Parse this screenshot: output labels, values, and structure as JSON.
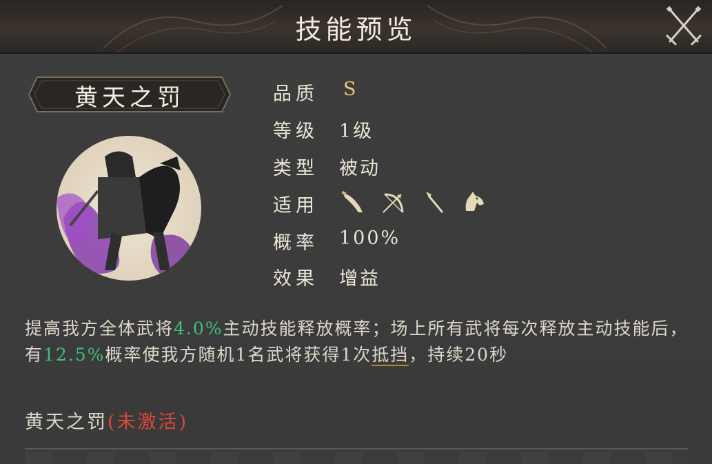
{
  "header": {
    "title": "技能预览",
    "close_icon": "crossed-swords-icon"
  },
  "skill": {
    "name": "黄天之罚",
    "portrait": "mounted-warrior-purple-aura",
    "attributes": {
      "quality_label": "品质",
      "quality_value": "S",
      "level_label": "等级",
      "level_value": "1级",
      "type_label": "类型",
      "type_value": "被动",
      "applicable_label": "适用",
      "applicable_icons": [
        "blade-icon",
        "bow-icon",
        "spear-icon",
        "horse-icon"
      ],
      "rate_label": "概率",
      "rate_value": "100%",
      "effect_label": "效果",
      "effect_value": "增益"
    },
    "description": {
      "p1": "提高我方全体武将",
      "v1": "4.0%",
      "p2": "主动技能释放概率；场上所有武将每次释放主动技能后，有",
      "v2": "12.5%",
      "p3": "概率使我方随机1名武将获得1次",
      "keyword": "抵挡",
      "p4": "，持续20秒"
    },
    "status": {
      "name": "黄天之罚",
      "state": "(未激活)"
    }
  },
  "colors": {
    "accent_gold": "#e8c676",
    "highlight_green": "#3fbf7a",
    "inactive_red": "#d9473c",
    "keyword_underline": "#b98a2c"
  }
}
